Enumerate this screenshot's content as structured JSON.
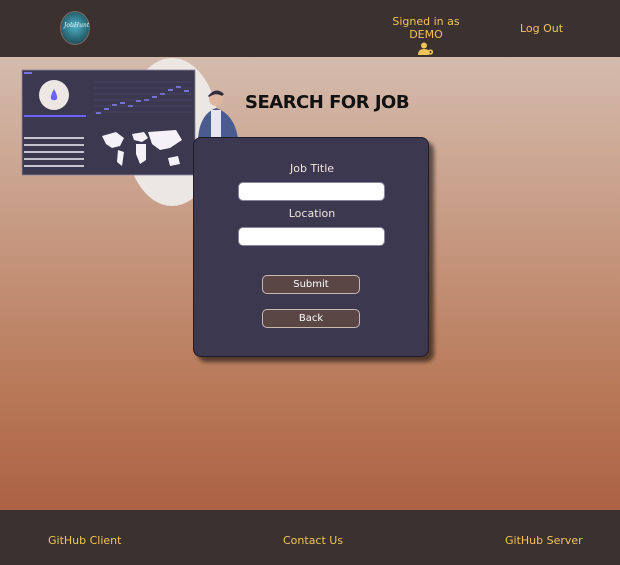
{
  "header": {
    "logo_text": "JobHunt",
    "signed_in_text": "Signed in as DEMO",
    "user_icon": "user-gear-icon",
    "logout_label": "Log Out"
  },
  "main": {
    "title": "SEARCH FOR JOB",
    "form": {
      "job_title_label": "Job Title",
      "job_title_value": "",
      "location_label": "Location",
      "location_value": "",
      "submit_label": "Submit",
      "back_label": "Back"
    }
  },
  "footer": {
    "links": [
      "GitHub Client",
      "Contact Us",
      "GitHub Server"
    ]
  },
  "colors": {
    "bar_bg": "#3b312f",
    "accent": "#f1c45a",
    "card_bg": "#3b3850",
    "button_bg": "#5a4644"
  }
}
